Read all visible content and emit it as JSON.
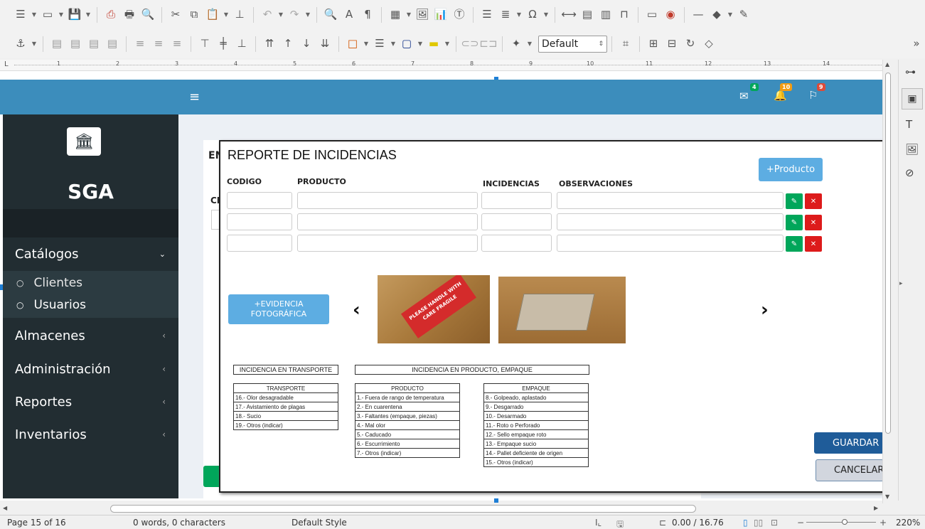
{
  "style_box": {
    "value": "Default"
  },
  "ruler": {
    "marks": [
      "1",
      "2",
      "3",
      "4",
      "5",
      "6",
      "7",
      "8",
      "9",
      "10",
      "11",
      "12",
      "13",
      "14"
    ]
  },
  "app": {
    "brand": "SGA",
    "notifications": {
      "mail": "4",
      "bell": "10",
      "flag": "9"
    },
    "nav": [
      {
        "label": "Catálogos"
      },
      {
        "label": "Almacenes"
      },
      {
        "label": "Administración"
      },
      {
        "label": "Reportes"
      },
      {
        "label": "Inventarios"
      }
    ],
    "subnav": [
      "Clientes",
      "Usuarios"
    ],
    "behind": {
      "title_fragment": "EN",
      "label_fragment": "CI"
    }
  },
  "modal": {
    "title": "REPORTE DE INCIDENCIAS",
    "add_product": "+Producto",
    "headers": {
      "codigo": "CODIGO",
      "producto": "PRODUCTO",
      "incidencias": "INCIDENCIAS",
      "observaciones": "OBSERVACIONES"
    },
    "evidence_button": "+EVIDENCIA FOTOGRÁFICA",
    "guardar": "GUARDAR",
    "cancelar": "CANCELAR",
    "photo1_label": "PLEASE HANDLE WITH CARE FRAGILE",
    "box_transport": "INCIDENCIA EN TRANSPORTE",
    "box_product": "INCIDENCIA EN PRODUCTO, EMPAQUE",
    "transporte": {
      "header": "TRANSPORTE",
      "rows": [
        "16.- Olor desagradable",
        "17.- Avistamiento de plagas",
        "18.- Sucio",
        "19.- Otros (indicar)"
      ]
    },
    "producto": {
      "header": "PRODUCTO",
      "rows": [
        "1.- Fuera de rango de temperatura",
        "2.- En cuarentena",
        "3.- Faltantes (empaque, piezas)",
        "4.- Mal olor",
        "5.- Caducado",
        "6.- Escurrimiento",
        "7.- Otros (indicar)"
      ]
    },
    "empaque": {
      "header": "EMPAQUE",
      "rows": [
        "8.- Golpeado, aplastado",
        "9.- Desgarrado",
        "10.- Desarmado",
        "11.- Roto o Perforado",
        "12.- Sello empaque roto",
        "13.- Empaque sucio",
        "14.- Pallet deficiente de origen",
        "15.- Otros (indicar)"
      ]
    }
  },
  "status": {
    "page": "Page 15 of 16",
    "words": "0 words, 0 characters",
    "style": "Default Style",
    "position": "0.00 / 16.76",
    "zoom": "220%"
  }
}
